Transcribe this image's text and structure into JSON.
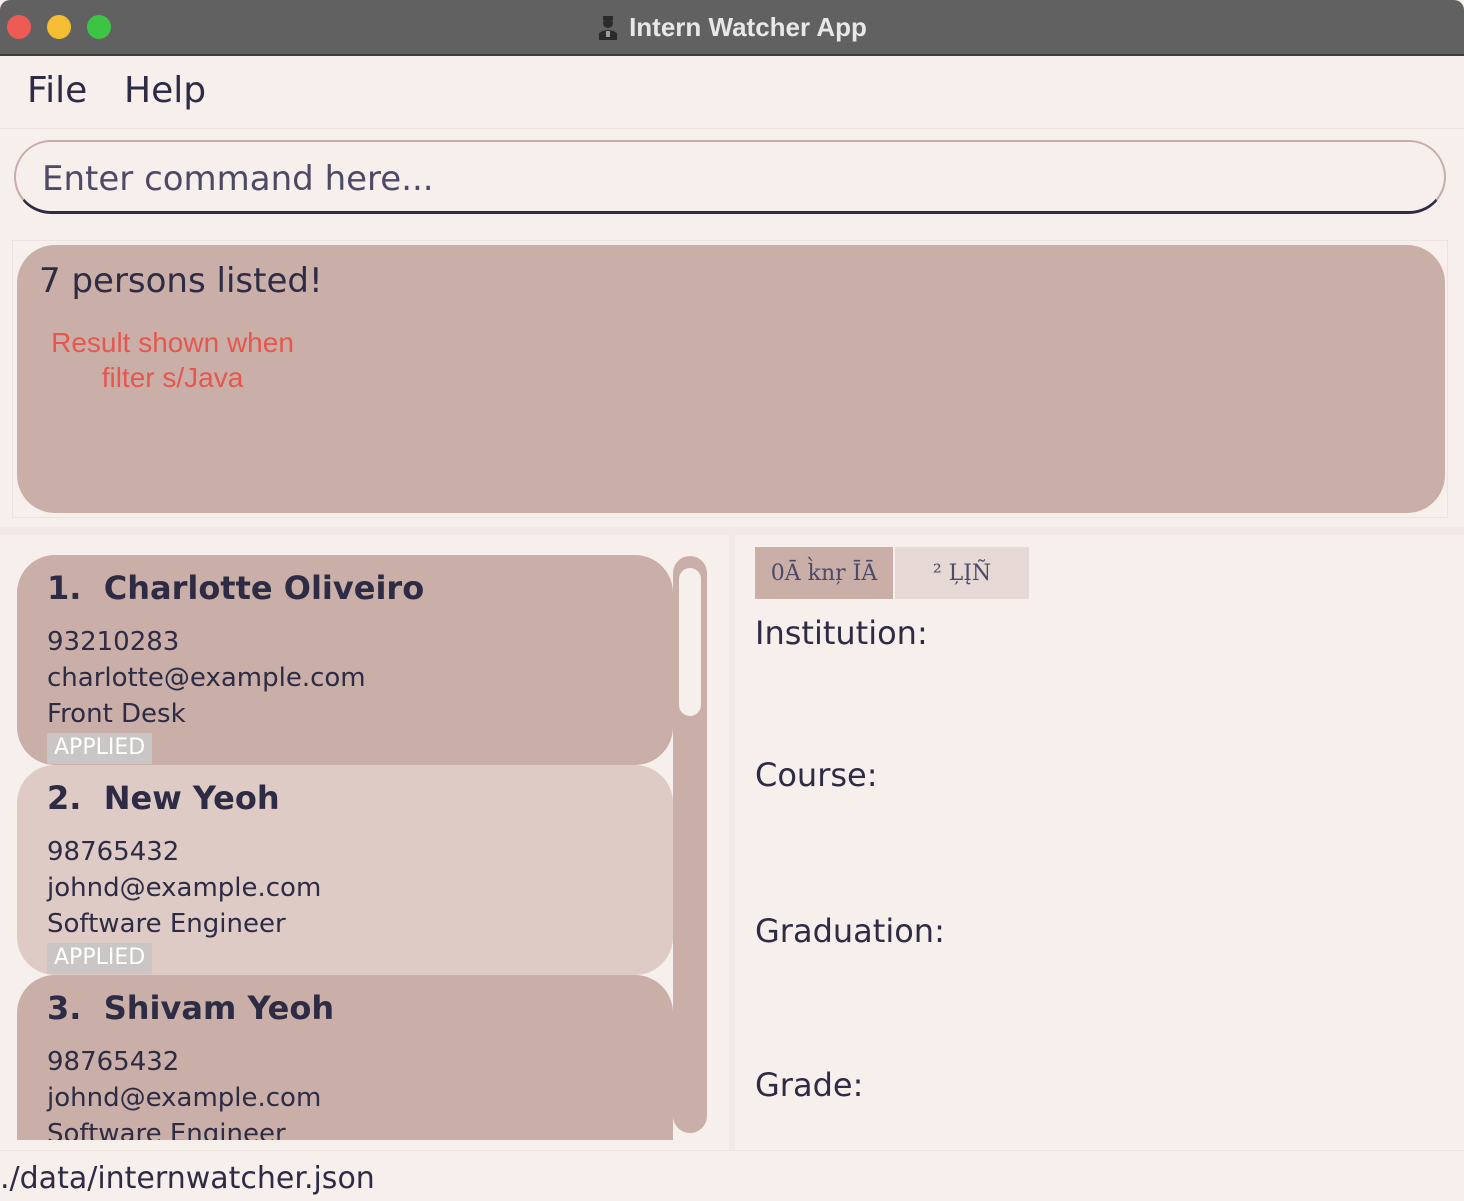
{
  "window": {
    "title": "Intern Watcher App",
    "icon": "person-icon",
    "buttons": [
      "close",
      "minimize",
      "maximize"
    ]
  },
  "menu": {
    "file": "File",
    "help": "Help"
  },
  "command": {
    "placeholder": "Enter command here..."
  },
  "result": {
    "message": "7 persons listed!",
    "annotation_line1": "Result shown when",
    "annotation_line2": "filter s/Java"
  },
  "persons": [
    {
      "index": "1.",
      "name": "Charlotte Oliveiro",
      "phone": "93210283",
      "email": "charlotte@example.com",
      "role": "Front Desk",
      "status": "APPLIED"
    },
    {
      "index": "2.",
      "name": "New Yeoh",
      "phone": "98765432",
      "email": "johnd@example.com",
      "role": "Software Engineer",
      "status": "APPLIED"
    },
    {
      "index": "3.",
      "name": "Shivam Yeoh",
      "phone": "98765432",
      "email": "johnd@example.com",
      "role": "Software Engineer",
      "status": ""
    }
  ],
  "tabs": [
    "0Ā k̀nŗ ĪĀ",
    "² ĻĮÑ"
  ],
  "details": {
    "institution": "Institution:",
    "course": "Course:",
    "graduation": "Graduation:",
    "grade": "Grade:"
  },
  "status_bar": {
    "path": "./data/internwatcher.json"
  },
  "colors": {
    "background": "#f7efec",
    "card_dark": "#c9afa8",
    "card_light": "#decbc6",
    "text": "#2e2b45",
    "annotation": "#e5574f",
    "titlebar": "#626161"
  }
}
